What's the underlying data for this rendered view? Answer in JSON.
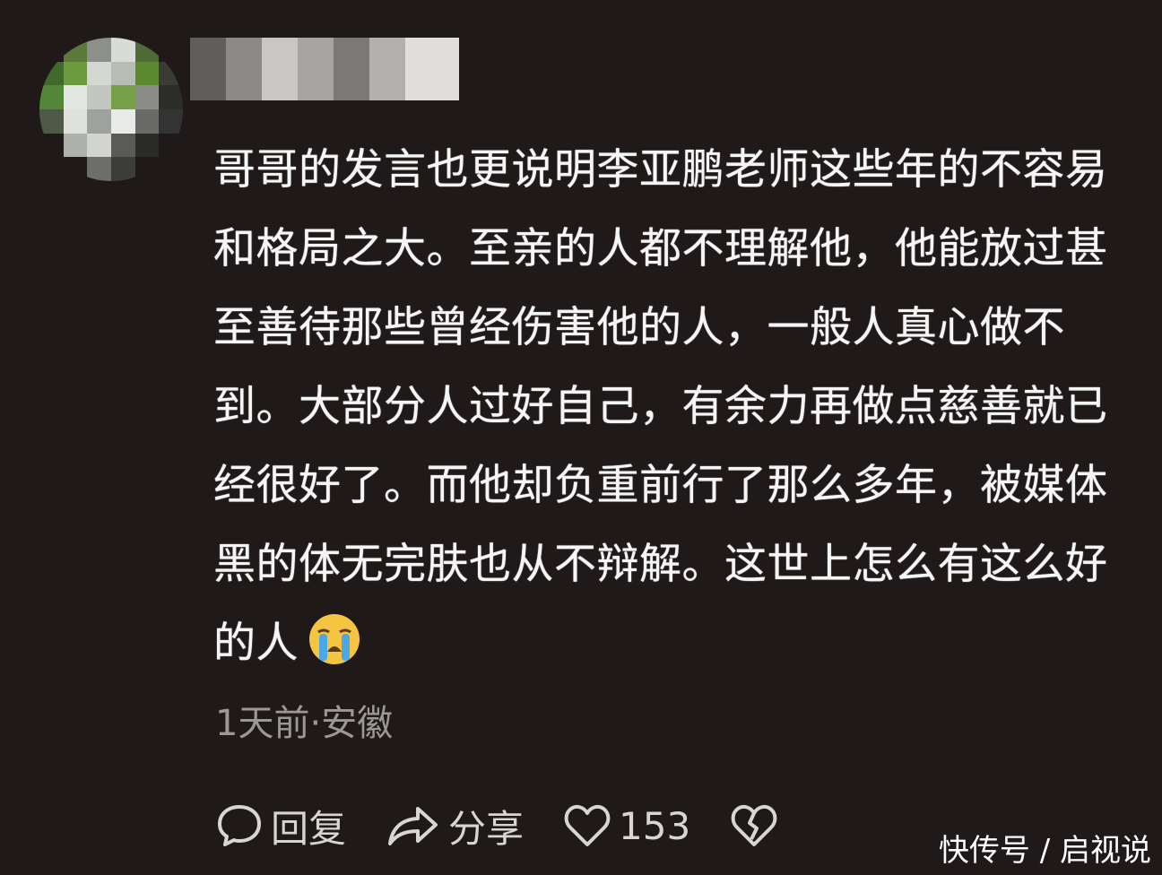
{
  "comment": {
    "text": "哥哥的发言也更说明李亚鹏老师这些年的不容易和格局之大。至亲的人都不理解他，他能放过甚至善待那些曾经伤害他的人，一般人真心做不到。大部分人过好自己，有余力再做点慈善就已经很好了。而他却负重前行了那么多年，被媒体黑的体无完肤也从不辩解。这世上怎么有这么好的人",
    "emoji_icon": "loudly-crying-face-icon"
  },
  "meta": {
    "time_location": "1天前·安徽"
  },
  "actions": {
    "reply_label": "回复",
    "share_label": "分享",
    "like_count": "153"
  },
  "watermark": {
    "text": "快传号 / 启视说"
  },
  "colors": {
    "background": "#1f1a19",
    "text": "#f5f5f5",
    "meta": "#9b9896",
    "emoji_yellow": "#f5c542",
    "emoji_tear": "#4aa8e8"
  }
}
